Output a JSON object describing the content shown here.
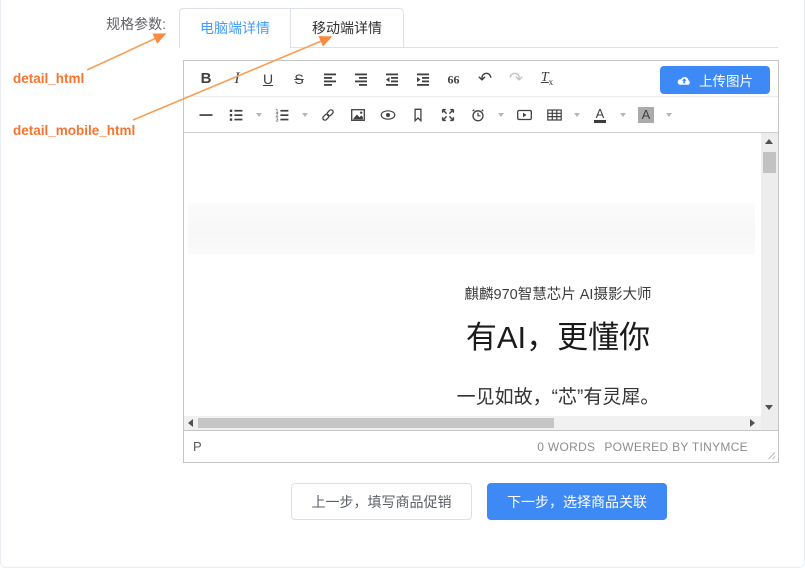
{
  "form": {
    "spec_label": "规格参数:"
  },
  "annotations": {
    "detail_html": "detail_html",
    "detail_mobile_html": "detail_mobile_html"
  },
  "tabs": {
    "pc": "电脑端详情",
    "mobile": "移动端详情"
  },
  "editor": {
    "upload_button": "上传图片",
    "toolbar": {
      "bold": "B",
      "italic": "I",
      "underline": "U",
      "strikethrough": "S",
      "undo": "↶",
      "redo": "↷",
      "removeformat_t": "T",
      "removeformat_x": "x",
      "forecolor": "A",
      "backcolor": "A"
    },
    "content": {
      "line1": "麒麟970智慧芯片 AI摄影大师",
      "line2": "有AI，更懂你",
      "line3": "一见如故，“芯”有灵犀。"
    },
    "statusbar": {
      "path": "P",
      "wordcount": "0 WORDS",
      "branding": "POWERED BY TINYMCE"
    }
  },
  "footer": {
    "prev_button": "上一步，填写商品促销",
    "next_button": "下一步，选择商品关联"
  },
  "colors": {
    "tab_active": "#409eff",
    "primary_blue": "#3d8af7",
    "annotation_text": "#f7742e",
    "annotation_arrow": "#f99e55"
  }
}
